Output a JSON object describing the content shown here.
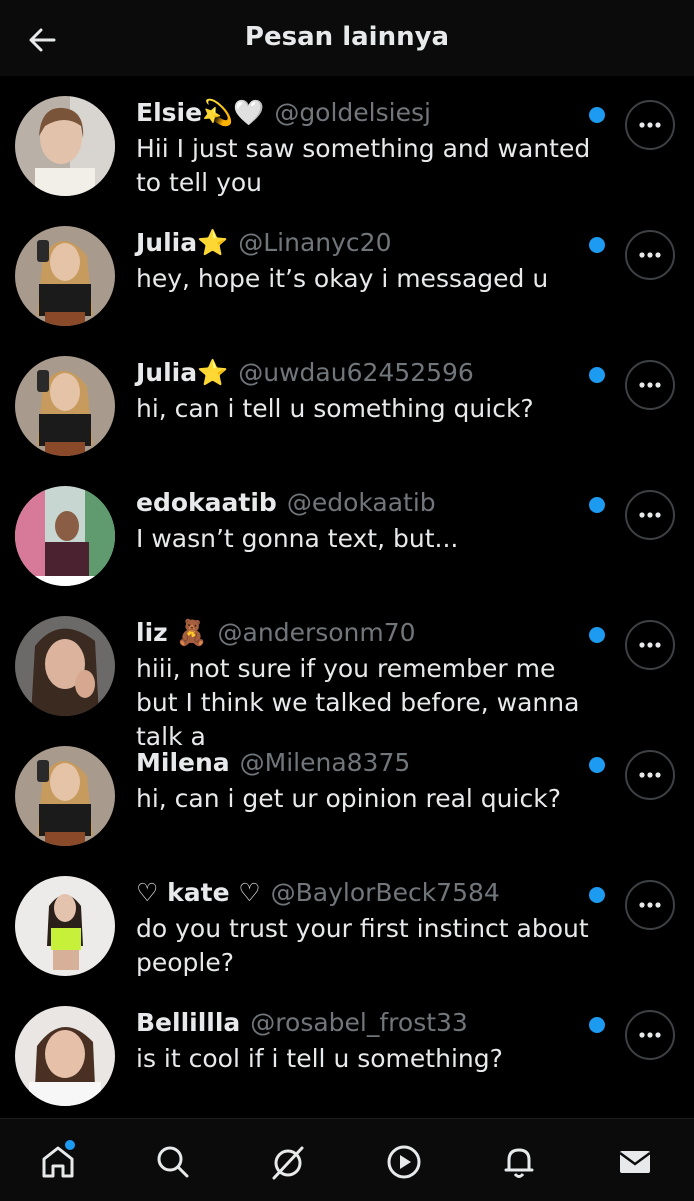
{
  "header": {
    "title": "Pesan lainnya",
    "back_icon": "arrow-left-icon"
  },
  "conversations": [
    {
      "name": "Elsie💫🤍",
      "handle": "@goldelsiesj",
      "message": "Hii I just saw something and wanted to tell you",
      "unread": true
    },
    {
      "name": "Julia⭐",
      "handle": "@Linanyc20",
      "message": "hey, hope it’s okay i messaged u",
      "unread": true
    },
    {
      "name": "Julia⭐",
      "handle": "@uwdau62452596",
      "message": "hi, can i tell u something quick?",
      "unread": true
    },
    {
      "name": "edokaatib",
      "handle": "@edokaatib",
      "message": "I wasn’t gonna text, but...",
      "unread": true
    },
    {
      "name": "liz 🧸",
      "handle": "@andersonm70",
      "message": "hiii, not sure if you remember me but I think we talked before, wanna talk a",
      "unread": true
    },
    {
      "name": "Milena",
      "handle": "@Milena8375",
      "message": "hi, can i get ur opinion real quick?",
      "unread": true
    },
    {
      "name": "♡ kate ♡",
      "handle": "@BaylorBeck7584",
      "message": "do you trust your first instinct about people?",
      "unread": true
    },
    {
      "name": "Bellillla",
      "handle": "@rosabel_frost33",
      "message": "is it cool if i tell u something?",
      "unread": true
    }
  ],
  "bottom_nav": {
    "items": [
      "home-icon",
      "search-icon",
      "grok-icon",
      "play-icon",
      "bell-icon",
      "mail-icon"
    ],
    "home_has_notification": true
  },
  "colors": {
    "accent": "#1d9bf0",
    "background": "#000000",
    "muted_text": "#71767b"
  }
}
